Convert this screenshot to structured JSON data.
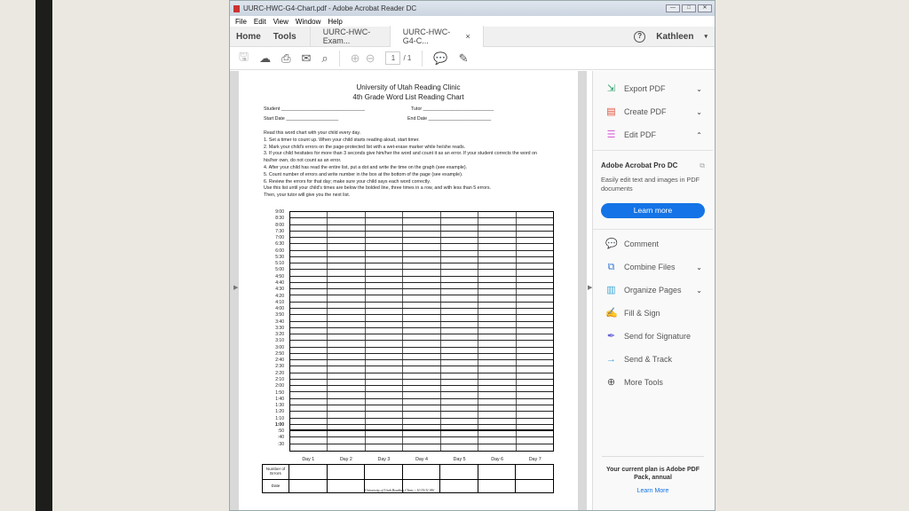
{
  "window": {
    "title": "UURC-HWC-G4-Chart.pdf - Adobe Acrobat Reader DC",
    "controls": [
      "—",
      "□",
      "✕"
    ]
  },
  "menu": [
    "File",
    "Edit",
    "View",
    "Window",
    "Help"
  ],
  "tabs": {
    "home": "Home",
    "tools": "Tools",
    "docs": [
      {
        "label": "UURC-HWC-Exam..."
      },
      {
        "label": "UURC-HWC-G4-C...",
        "close": "×"
      }
    ],
    "user": "Kathleen"
  },
  "toolbar": {
    "page_current": "1",
    "page_total": "/ 1"
  },
  "document": {
    "title1": "University of Utah Reading Clinic",
    "title2": "4th Grade Word List Reading Chart",
    "student": "Student ________________________________",
    "tutor": "Tutor ___________________________",
    "start": "Start Date ____________________",
    "end": "End Date ________________________",
    "instructions": [
      "Read this word chart with your child every day.",
      "1. Set a timer to count up. When your child starts reading aloud, start timer.",
      "2. Mark your child's errors on the page-protected list with a wet-erase marker while he/she reads.",
      "3. If your child hesitates for more than 3 seconds give him/her the word and count it as an error. If your student corrects the word on his/her own, do not count as an error.",
      "4. After your child has read the entire list, put a dot and write the time on the graph (see example).",
      "5. Count number of errors and write number in the box at the bottom of the page (see example).",
      "6. Review the errors for that day; make sure your child says each word correctly.",
      "Use this list until your child's times are below the bolded line, three times in a row, and with less than 5 errors.",
      "Then, your tutor will give you the next list."
    ],
    "times": [
      "9:00",
      "8:30",
      "8:00",
      "7:30",
      "7:00",
      "6:30",
      "6:00",
      "5:30",
      "5:10",
      "5:00",
      "4:50",
      "4:40",
      "4:30",
      "4:20",
      "4:10",
      "4:00",
      "3:50",
      "3:40",
      "3:30",
      "3:20",
      "3:10",
      "3:00",
      "2:50",
      "2:40",
      "2:30",
      "2:20",
      "2:10",
      "2:00",
      "1:50",
      "1:40",
      "1:30",
      "1:20",
      "1:10",
      "1:00",
      ":50",
      ":40",
      ":30"
    ],
    "days": [
      "Day 1",
      "Day 2",
      "Day 3",
      "Day 4",
      "Day 5",
      "Day 6",
      "Day 7"
    ],
    "errors_label": "Number of Errors",
    "date_label": "Date",
    "footer": "University of Utah Reading Clinic - 11/15/11 SW"
  },
  "pane": {
    "top": [
      {
        "label": "Export PDF",
        "icon": "export-pdf-icon",
        "color": "#2e9d6b"
      },
      {
        "label": "Create PDF",
        "icon": "create-pdf-icon",
        "color": "#e0523f"
      },
      {
        "label": "Edit PDF",
        "icon": "edit-pdf-icon",
        "color": "#d964d9"
      }
    ],
    "promo": {
      "title": "Adobe Acrobat Pro DC",
      "desc": "Easily edit text and images in PDF documents",
      "button": "Learn more"
    },
    "tools": [
      {
        "label": "Comment",
        "icon": "comment-icon",
        "color": "#f2b632",
        "chev": false
      },
      {
        "label": "Combine Files",
        "icon": "combine-files-icon",
        "color": "#3d7fd6",
        "chev": true
      },
      {
        "label": "Organize Pages",
        "icon": "organize-pages-icon",
        "color": "#40a8d8",
        "chev": true
      },
      {
        "label": "Fill & Sign",
        "icon": "fill-sign-icon",
        "color": "#8a6fd8",
        "chev": false
      },
      {
        "label": "Send for Signature",
        "icon": "send-signature-icon",
        "color": "#6b67d6",
        "chev": false
      },
      {
        "label": "Send & Track",
        "icon": "send-track-icon",
        "color": "#3aa0d8",
        "chev": false
      },
      {
        "label": "More Tools",
        "icon": "more-tools-icon",
        "color": "#555",
        "chev": false
      }
    ],
    "plan": "Your current plan is Adobe PDF Pack, annual",
    "plan_link": "Learn More"
  },
  "colors": {
    "accent": "#1473e6"
  }
}
